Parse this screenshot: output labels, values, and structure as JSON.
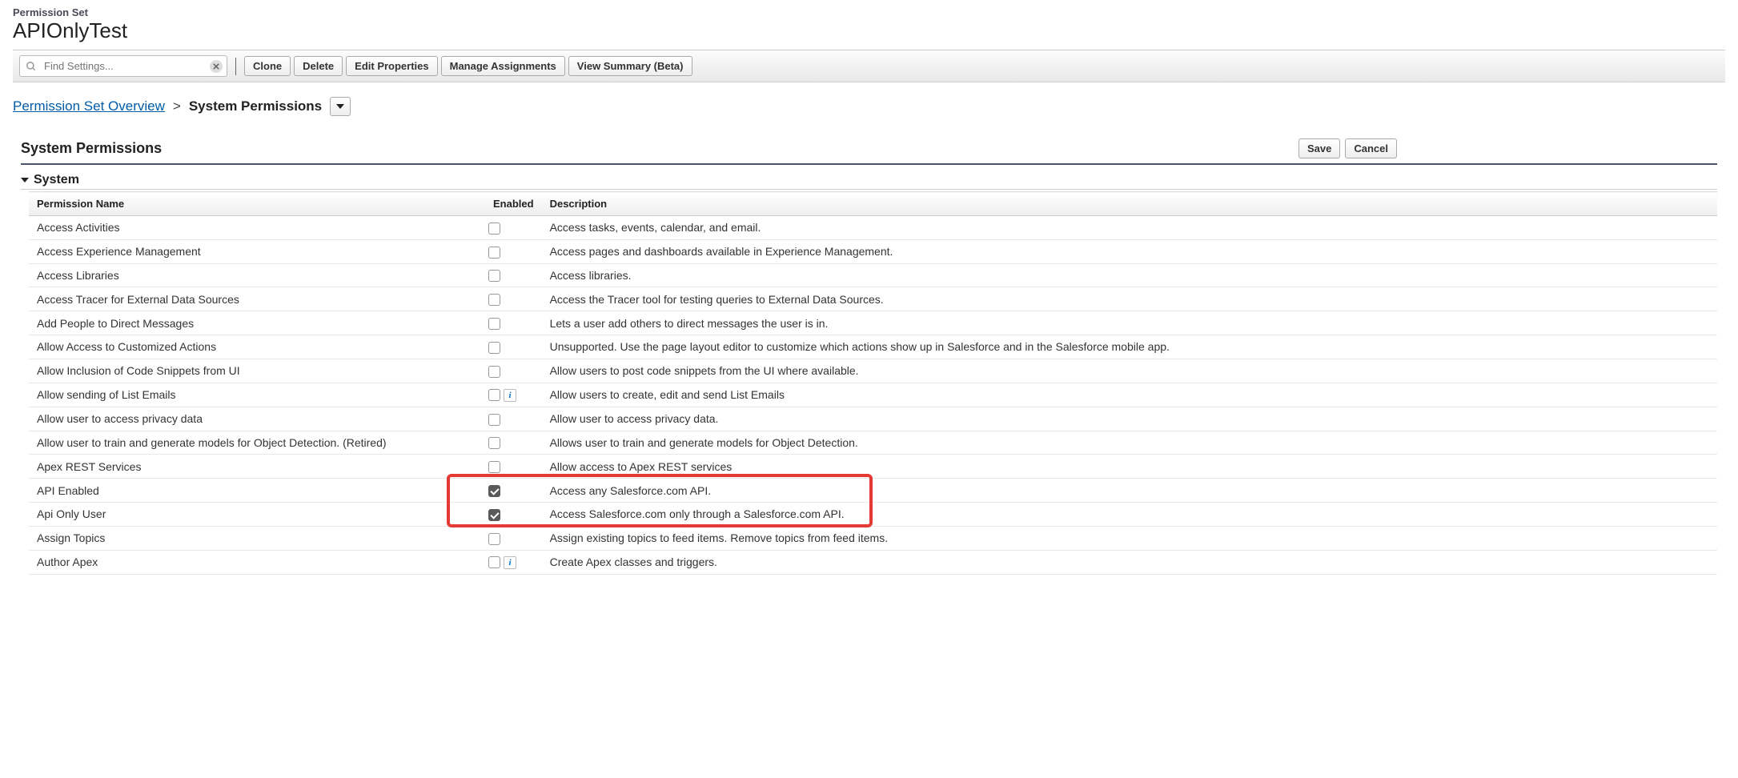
{
  "header": {
    "subtitle": "Permission Set",
    "title": "APIOnlyTest"
  },
  "search": {
    "placeholder": "Find Settings..."
  },
  "toolbar": {
    "clone": "Clone",
    "delete": "Delete",
    "edit_properties": "Edit Properties",
    "manage_assignments": "Manage Assignments",
    "view_summary": "View Summary (Beta)"
  },
  "breadcrumb": {
    "link": "Permission Set Overview",
    "sep": ">",
    "current": "System Permissions"
  },
  "section": {
    "title": "System Permissions",
    "save": "Save",
    "cancel": "Cancel"
  },
  "group": {
    "title": "System"
  },
  "table": {
    "headers": {
      "name": "Permission Name",
      "enabled": "Enabled",
      "description": "Description"
    },
    "rows": [
      {
        "name": "Access Activities",
        "enabled": false,
        "info": false,
        "description": "Access tasks, events, calendar, and email."
      },
      {
        "name": "Access Experience Management",
        "enabled": false,
        "info": false,
        "description": "Access pages and dashboards available in Experience Management."
      },
      {
        "name": "Access Libraries",
        "enabled": false,
        "info": false,
        "description": "Access libraries."
      },
      {
        "name": "Access Tracer for External Data Sources",
        "enabled": false,
        "info": false,
        "description": "Access the Tracer tool for testing queries to External Data Sources."
      },
      {
        "name": "Add People to Direct Messages",
        "enabled": false,
        "info": false,
        "description": "Lets a user add others to direct messages the user is in."
      },
      {
        "name": "Allow Access to Customized Actions",
        "enabled": false,
        "info": false,
        "description": "Unsupported. Use the page layout editor to customize which actions show up in Salesforce and in the Salesforce mobile app."
      },
      {
        "name": "Allow Inclusion of Code Snippets from UI",
        "enabled": false,
        "info": false,
        "description": "Allow users to post code snippets from the UI where available."
      },
      {
        "name": "Allow sending of List Emails",
        "enabled": false,
        "info": true,
        "description": "Allow users to create, edit and send List Emails"
      },
      {
        "name": "Allow user to access privacy data",
        "enabled": false,
        "info": false,
        "description": "Allow user to access privacy data."
      },
      {
        "name": "Allow user to train and generate models for Object Detection. (Retired)",
        "enabled": false,
        "info": false,
        "description": "Allows user to train and generate models for Object Detection."
      },
      {
        "name": "Apex REST Services",
        "enabled": false,
        "info": false,
        "description": "Allow access to Apex REST services"
      },
      {
        "name": "API Enabled",
        "enabled": true,
        "info": false,
        "description": "Access any Salesforce.com API."
      },
      {
        "name": "Api Only User",
        "enabled": true,
        "info": false,
        "description": "Access Salesforce.com only through a Salesforce.com API."
      },
      {
        "name": "Assign Topics",
        "enabled": false,
        "info": false,
        "description": "Assign existing topics to feed items. Remove topics from feed items."
      },
      {
        "name": "Author Apex",
        "enabled": false,
        "info": true,
        "description": "Create Apex classes and triggers."
      }
    ]
  },
  "info_glyph": "i"
}
